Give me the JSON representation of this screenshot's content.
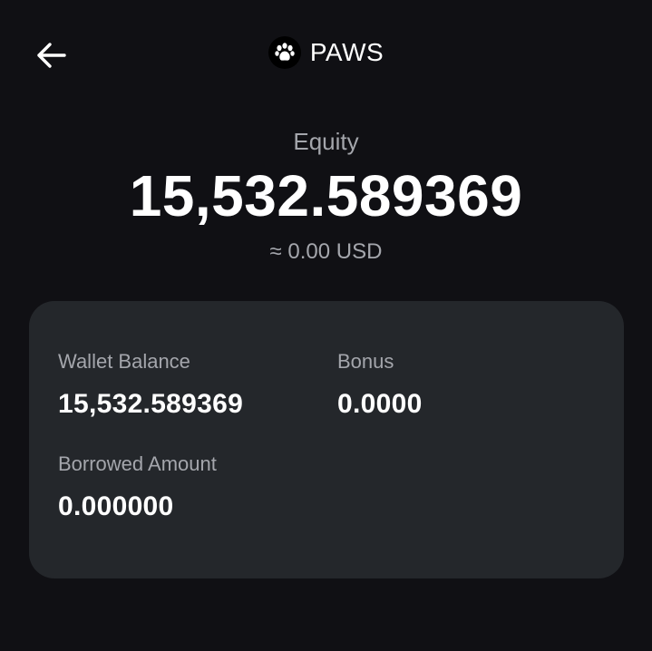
{
  "header": {
    "back_icon": "arrow-left-icon",
    "coin_logo_icon": "paw-print-icon",
    "coin_name": "PAWS"
  },
  "equity": {
    "label": "Equity",
    "value": "15,532.589369",
    "usd_value": "≈ 0.00 USD"
  },
  "details": {
    "wallet_balance_label": "Wallet Balance",
    "wallet_balance_value": "15,532.589369",
    "bonus_label": "Bonus",
    "bonus_value": "0.0000",
    "borrowed_amount_label": "Borrowed Amount",
    "borrowed_amount_value": "0.000000"
  },
  "colors": {
    "background": "#101014",
    "card": "#24272b",
    "primary_text": "#ffffff",
    "secondary_text": "#a4a6ac"
  }
}
